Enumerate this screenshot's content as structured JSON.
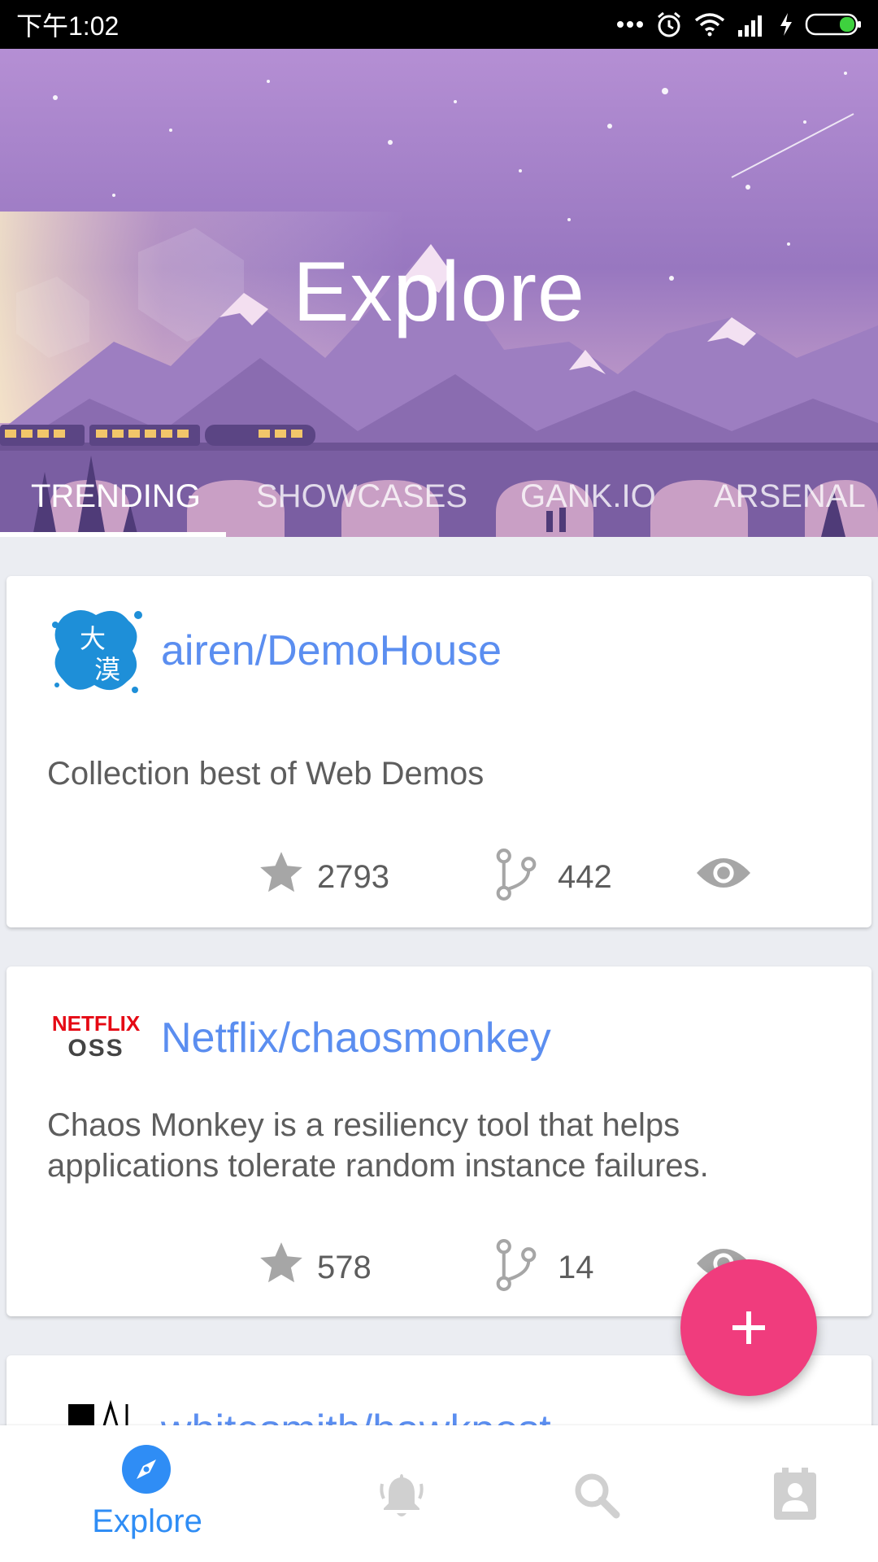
{
  "status_bar": {
    "time": "下午1:02"
  },
  "header": {
    "title": "Explore",
    "tabs": [
      {
        "label": "TRENDING",
        "active": true
      },
      {
        "label": "SHOWCASES",
        "active": false
      },
      {
        "label": "GANK.IO",
        "active": false
      },
      {
        "label": "ARSENAL",
        "active": false
      }
    ]
  },
  "repos": [
    {
      "name": "airen/DemoHouse",
      "description": "Collection best of Web Demos",
      "stars": "2793",
      "forks": "442",
      "avatar_text": [
        "大",
        "漠"
      ]
    },
    {
      "name": "Netflix/chaosmonkey",
      "description": "Chaos Monkey is a resiliency tool that helps applications tolerate random instance failures.",
      "stars": "578",
      "forks": "14",
      "avatar_text": [
        "NETFLIX",
        "OSS"
      ]
    },
    {
      "name": "whitesmith/hawkpost"
    }
  ],
  "fab": {
    "icon": "plus-icon"
  },
  "bottom_nav": [
    {
      "label": "Explore",
      "icon": "compass-icon",
      "active": true
    },
    {
      "label": "",
      "icon": "bell-icon",
      "active": false
    },
    {
      "label": "",
      "icon": "search-icon",
      "active": false
    },
    {
      "label": "",
      "icon": "contact-icon",
      "active": false
    }
  ],
  "colors": {
    "accent": "#2f8df5",
    "link": "#5b8ef0",
    "fab": "#f03c7d",
    "icon_gray": "#a6a6a6"
  }
}
